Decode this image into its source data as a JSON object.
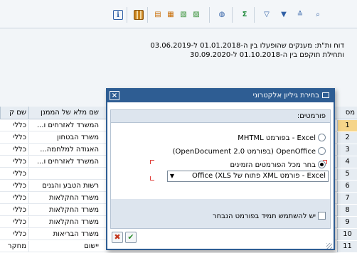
{
  "toolbar": {
    "icons": [
      "info-icon",
      "grid-layout-icon",
      "export-icon",
      "export-html-icon",
      "export-word-icon",
      "export-excel-icon",
      "view-icon",
      "sum-icon",
      "filter-icon",
      "sort-icon",
      "find-icon"
    ]
  },
  "report": {
    "line1": "דוח ות\"ת: מענקים שהופעלו בין ה-01.01.2018 ל-03.06.2019",
    "line2": "ותחילת תוקפם בין ה-01.10.2018 ל-30.09.2020"
  },
  "table": {
    "headers": {
      "name": "שם מלא של הממנן",
      "short": "שם ק",
      "num": "מס"
    },
    "rows": [
      {
        "num": "1",
        "name": "המשרד לאזרחים ו...",
        "short": "כללי"
      },
      {
        "num": "2",
        "name": "משרד הבטחון",
        "short": "כללי"
      },
      {
        "num": "3",
        "name": "האגודה למלחמה...",
        "short": "כללי"
      },
      {
        "num": "4",
        "name": "המשרד לאזרחים ו...",
        "short": "כללי"
      },
      {
        "num": "5",
        "name": "",
        "short": "כללי"
      },
      {
        "num": "6",
        "name": "רשות הטבע והגנים",
        "short": "כללי"
      },
      {
        "num": "7",
        "name": "משרד החקלאות",
        "short": "כללי"
      },
      {
        "num": "8",
        "name": "משרד החקלאות",
        "short": "כללי"
      },
      {
        "num": "9",
        "name": "משרד החקלאות",
        "short": "כללי"
      },
      {
        "num": "10",
        "name": "משרד הבריאות",
        "short": "כללי"
      },
      {
        "num": "11",
        "name": "יישום",
        "short": "מחקר"
      }
    ]
  },
  "dialog": {
    "title": "בחירת גיליון אלקטרוני",
    "formats_label": "פורמטים:",
    "option1": "Excel - בפורמט MHTML",
    "option2": "OpenOffice (בפורמט OpenDocument 2.0)",
    "option3": "בחר מכל הפורמטים הזמינים",
    "selected_option": 3,
    "select_value": "Excel - פורמט XML פתוח של Office (XLS",
    "always_label": "יש להשתמש תמיד בפורמט הנבחר",
    "ok_icon": "checkmark-icon",
    "cancel_icon": "cancel-icon"
  }
}
